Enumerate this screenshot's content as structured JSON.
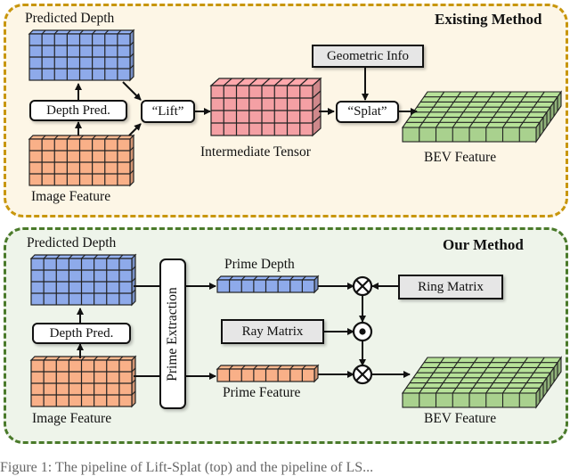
{
  "top_panel": {
    "title": "Existing Method",
    "border_color": "#c8960c",
    "fill_color": "#fdf6e6",
    "labels": {
      "predicted_depth": "Predicted Depth",
      "image_feature": "Image Feature",
      "intermediate_tensor": "Intermediate Tensor",
      "bev_feature": "BEV Feature"
    },
    "boxes": {
      "depth_pred": "Depth Pred.",
      "lift": "“Lift”",
      "splat": "“Splat”",
      "geometric_info": "Geometric Info"
    }
  },
  "bottom_panel": {
    "title": "Our Method",
    "border_color": "#4a7a2a",
    "fill_color": "#eef4ea",
    "labels": {
      "predicted_depth": "Predicted Depth",
      "image_feature": "Image Feature",
      "prime_depth": "Prime Depth",
      "prime_feature": "Prime Feature",
      "bev_feature": "BEV Feature"
    },
    "boxes": {
      "depth_pred": "Depth Pred.",
      "prime_extraction": "Prime Extraction",
      "ray_matrix": "Ray Matrix",
      "ring_matrix": "Ring Matrix"
    },
    "operators": [
      "otimes",
      "odot",
      "otimes"
    ]
  },
  "colors": {
    "depth_blue": "#8eaaea",
    "feature_orange": "#f9b088",
    "tensor_pink": "#f4a0a4",
    "bev_green": "#a9d18e"
  },
  "caption": "Figure 1: The pipeline of Lift-Splat (top) and the pipeline of LS..."
}
